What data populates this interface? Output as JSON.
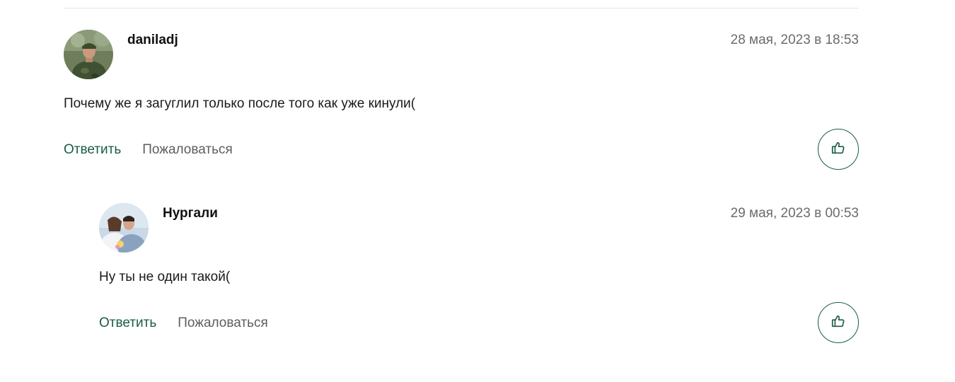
{
  "comments": [
    {
      "author": "daniladj",
      "date": "28 мая, 2023 в 18:53",
      "text": "Почему же я загуглил только после того как уже кинули(",
      "reply_label": "Ответить",
      "report_label": "Пожаловаться",
      "avatar_icon": "avatar-soldier-photo",
      "like_icon": "thumbs-up-icon"
    },
    {
      "author": "Нургали",
      "date": "29 мая, 2023 в 00:53",
      "text": "Ну ты не один такой(",
      "reply_label": "Ответить",
      "report_label": "Пожаловаться",
      "avatar_icon": "avatar-wedding-photo",
      "like_icon": "thumbs-up-icon"
    }
  ],
  "colors": {
    "accent": "#1a5c45",
    "muted": "#6b6b6b",
    "text": "#1a1a1a"
  }
}
